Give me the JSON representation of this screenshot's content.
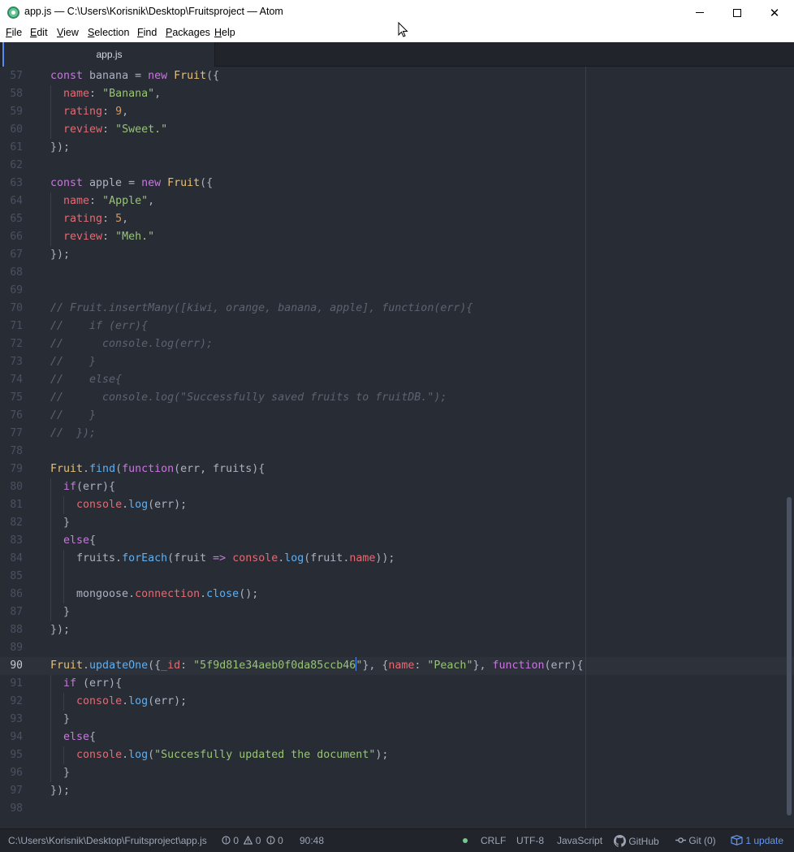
{
  "window": {
    "title": "app.js — C:\\Users\\Korisnik\\Desktop\\Fruitsproject — Atom",
    "close_glyph": "✕"
  },
  "menu": [
    {
      "key": "F",
      "rest": "ile"
    },
    {
      "key": "E",
      "rest": "dit"
    },
    {
      "key": "V",
      "rest": "iew"
    },
    {
      "key": "S",
      "rest": "election"
    },
    {
      "key": "F",
      "rest": "ind"
    },
    {
      "key": "P",
      "rest": "ackages"
    },
    {
      "key": "H",
      "rest": "elp"
    }
  ],
  "tabs": [
    {
      "title": "app.js",
      "active": true
    }
  ],
  "editor": {
    "current_line": 90,
    "lines": [
      {
        "n": 57,
        "code": [
          [
            "kw",
            "const"
          ],
          [
            "pl",
            " banana = "
          ],
          [
            "kw",
            "new"
          ],
          [
            "pl",
            " "
          ],
          [
            "cls",
            "Fruit"
          ],
          [
            "pl",
            "({"
          ]
        ]
      },
      {
        "n": 58,
        "code": [
          [
            "pl",
            "  "
          ],
          [
            "prop",
            "name"
          ],
          [
            "pl",
            ": "
          ],
          [
            "str",
            "\"Banana\""
          ],
          [
            "pl",
            ","
          ]
        ]
      },
      {
        "n": 59,
        "code": [
          [
            "pl",
            "  "
          ],
          [
            "prop",
            "rating"
          ],
          [
            "pl",
            ": "
          ],
          [
            "num",
            "9"
          ],
          [
            "pl",
            ","
          ]
        ]
      },
      {
        "n": 60,
        "code": [
          [
            "pl",
            "  "
          ],
          [
            "prop",
            "review"
          ],
          [
            "pl",
            ": "
          ],
          [
            "str",
            "\"Sweet.\""
          ]
        ]
      },
      {
        "n": 61,
        "code": [
          [
            "pl",
            "});"
          ]
        ]
      },
      {
        "n": 62,
        "code": []
      },
      {
        "n": 63,
        "code": [
          [
            "kw",
            "const"
          ],
          [
            "pl",
            " apple = "
          ],
          [
            "kw",
            "new"
          ],
          [
            "pl",
            " "
          ],
          [
            "cls",
            "Fruit"
          ],
          [
            "pl",
            "({"
          ]
        ]
      },
      {
        "n": 64,
        "code": [
          [
            "pl",
            "  "
          ],
          [
            "prop",
            "name"
          ],
          [
            "pl",
            ": "
          ],
          [
            "str",
            "\"Apple\""
          ],
          [
            "pl",
            ","
          ]
        ]
      },
      {
        "n": 65,
        "code": [
          [
            "pl",
            "  "
          ],
          [
            "prop",
            "rating"
          ],
          [
            "pl",
            ": "
          ],
          [
            "num",
            "5"
          ],
          [
            "pl",
            ","
          ]
        ]
      },
      {
        "n": 66,
        "code": [
          [
            "pl",
            "  "
          ],
          [
            "prop",
            "review"
          ],
          [
            "pl",
            ": "
          ],
          [
            "str",
            "\"Meh.\""
          ]
        ]
      },
      {
        "n": 67,
        "code": [
          [
            "pl",
            "});"
          ]
        ]
      },
      {
        "n": 68,
        "code": []
      },
      {
        "n": 69,
        "code": []
      },
      {
        "n": 70,
        "code": [
          [
            "cm",
            "// Fruit.insertMany([kiwi, orange, banana, apple], function(err){"
          ]
        ]
      },
      {
        "n": 71,
        "code": [
          [
            "cm",
            "//    if (err){"
          ]
        ]
      },
      {
        "n": 72,
        "code": [
          [
            "cm",
            "//      console.log(err);"
          ]
        ]
      },
      {
        "n": 73,
        "code": [
          [
            "cm",
            "//    }"
          ]
        ]
      },
      {
        "n": 74,
        "code": [
          [
            "cm",
            "//    else{"
          ]
        ]
      },
      {
        "n": 75,
        "code": [
          [
            "cm",
            "//      console.log(\"Successfully saved fruits to fruitDB.\");"
          ]
        ]
      },
      {
        "n": 76,
        "code": [
          [
            "cm",
            "//    }"
          ]
        ]
      },
      {
        "n": 77,
        "code": [
          [
            "cm",
            "//  });"
          ]
        ]
      },
      {
        "n": 78,
        "code": []
      },
      {
        "n": 79,
        "code": [
          [
            "cls",
            "Fruit"
          ],
          [
            "pl",
            "."
          ],
          [
            "fn",
            "find"
          ],
          [
            "pl",
            "("
          ],
          [
            "kw",
            "function"
          ],
          [
            "pl",
            "(err, fruits){"
          ]
        ]
      },
      {
        "n": 80,
        "code": [
          [
            "pl",
            "  "
          ],
          [
            "kw",
            "if"
          ],
          [
            "pl",
            "(err){"
          ]
        ]
      },
      {
        "n": 81,
        "code": [
          [
            "pl",
            "    "
          ],
          [
            "prop",
            "console"
          ],
          [
            "pl",
            "."
          ],
          [
            "fn",
            "log"
          ],
          [
            "pl",
            "(err);"
          ]
        ]
      },
      {
        "n": 82,
        "code": [
          [
            "pl",
            "  }"
          ]
        ]
      },
      {
        "n": 83,
        "code": [
          [
            "pl",
            "  "
          ],
          [
            "kw",
            "else"
          ],
          [
            "pl",
            "{"
          ]
        ]
      },
      {
        "n": 84,
        "code": [
          [
            "pl",
            "    fruits."
          ],
          [
            "fn",
            "forEach"
          ],
          [
            "pl",
            "(fruit "
          ],
          [
            "kw",
            "=>"
          ],
          [
            "pl",
            " "
          ],
          [
            "prop",
            "console"
          ],
          [
            "pl",
            "."
          ],
          [
            "fn",
            "log"
          ],
          [
            "pl",
            "(fruit."
          ],
          [
            "prop",
            "name"
          ],
          [
            "pl",
            "));"
          ]
        ]
      },
      {
        "n": 85,
        "code": []
      },
      {
        "n": 86,
        "code": [
          [
            "pl",
            "    mongoose."
          ],
          [
            "prop",
            "connection"
          ],
          [
            "pl",
            "."
          ],
          [
            "fn",
            "close"
          ],
          [
            "pl",
            "();"
          ]
        ]
      },
      {
        "n": 87,
        "code": [
          [
            "pl",
            "  }"
          ]
        ]
      },
      {
        "n": 88,
        "code": [
          [
            "pl",
            "});"
          ]
        ]
      },
      {
        "n": 89,
        "code": []
      },
      {
        "n": 90,
        "code": [
          [
            "cls",
            "Fruit"
          ],
          [
            "pl",
            "."
          ],
          [
            "fn",
            "updateOne"
          ],
          [
            "pl",
            "({"
          ],
          [
            "prop",
            "_id"
          ],
          [
            "pl",
            ": "
          ],
          [
            "str",
            "\"5f9d81e34aeb0f0da85ccb46"
          ],
          [
            "caret",
            ""
          ],
          [
            "str",
            "\""
          ],
          [
            "pl",
            "}, {"
          ],
          [
            "prop",
            "name"
          ],
          [
            "pl",
            ": "
          ],
          [
            "str",
            "\"Peach\""
          ],
          [
            "pl",
            "}, "
          ],
          [
            "kw",
            "function"
          ],
          [
            "pl",
            "(err){"
          ]
        ]
      },
      {
        "n": 91,
        "code": [
          [
            "pl",
            "  "
          ],
          [
            "kw",
            "if"
          ],
          [
            "pl",
            " (err){"
          ]
        ]
      },
      {
        "n": 92,
        "code": [
          [
            "pl",
            "    "
          ],
          [
            "prop",
            "console"
          ],
          [
            "pl",
            "."
          ],
          [
            "fn",
            "log"
          ],
          [
            "pl",
            "(err);"
          ]
        ]
      },
      {
        "n": 93,
        "code": [
          [
            "pl",
            "  }"
          ]
        ]
      },
      {
        "n": 94,
        "code": [
          [
            "pl",
            "  "
          ],
          [
            "kw",
            "else"
          ],
          [
            "pl",
            "{"
          ]
        ]
      },
      {
        "n": 95,
        "code": [
          [
            "pl",
            "    "
          ],
          [
            "prop",
            "console"
          ],
          [
            "pl",
            "."
          ],
          [
            "fn",
            "log"
          ],
          [
            "pl",
            "("
          ],
          [
            "str",
            "\"Succesfully updated the document\""
          ],
          [
            "pl",
            ");"
          ]
        ]
      },
      {
        "n": 96,
        "code": [
          [
            "pl",
            "  }"
          ]
        ]
      },
      {
        "n": 97,
        "code": [
          [
            "pl",
            "});"
          ]
        ]
      },
      {
        "n": 98,
        "code": []
      }
    ]
  },
  "statusbar": {
    "file_path": "C:\\Users\\Korisnik\\Desktop\\Fruitsproject\\app.js",
    "errors": "0",
    "warnings": "0",
    "infos": "0",
    "cursor_position": "90:48",
    "line_ending": "CRLF",
    "encoding": "UTF-8",
    "grammar": "JavaScript",
    "github_label": "GitHub",
    "git_label": "Git (0)",
    "update_label": "1 update"
  }
}
